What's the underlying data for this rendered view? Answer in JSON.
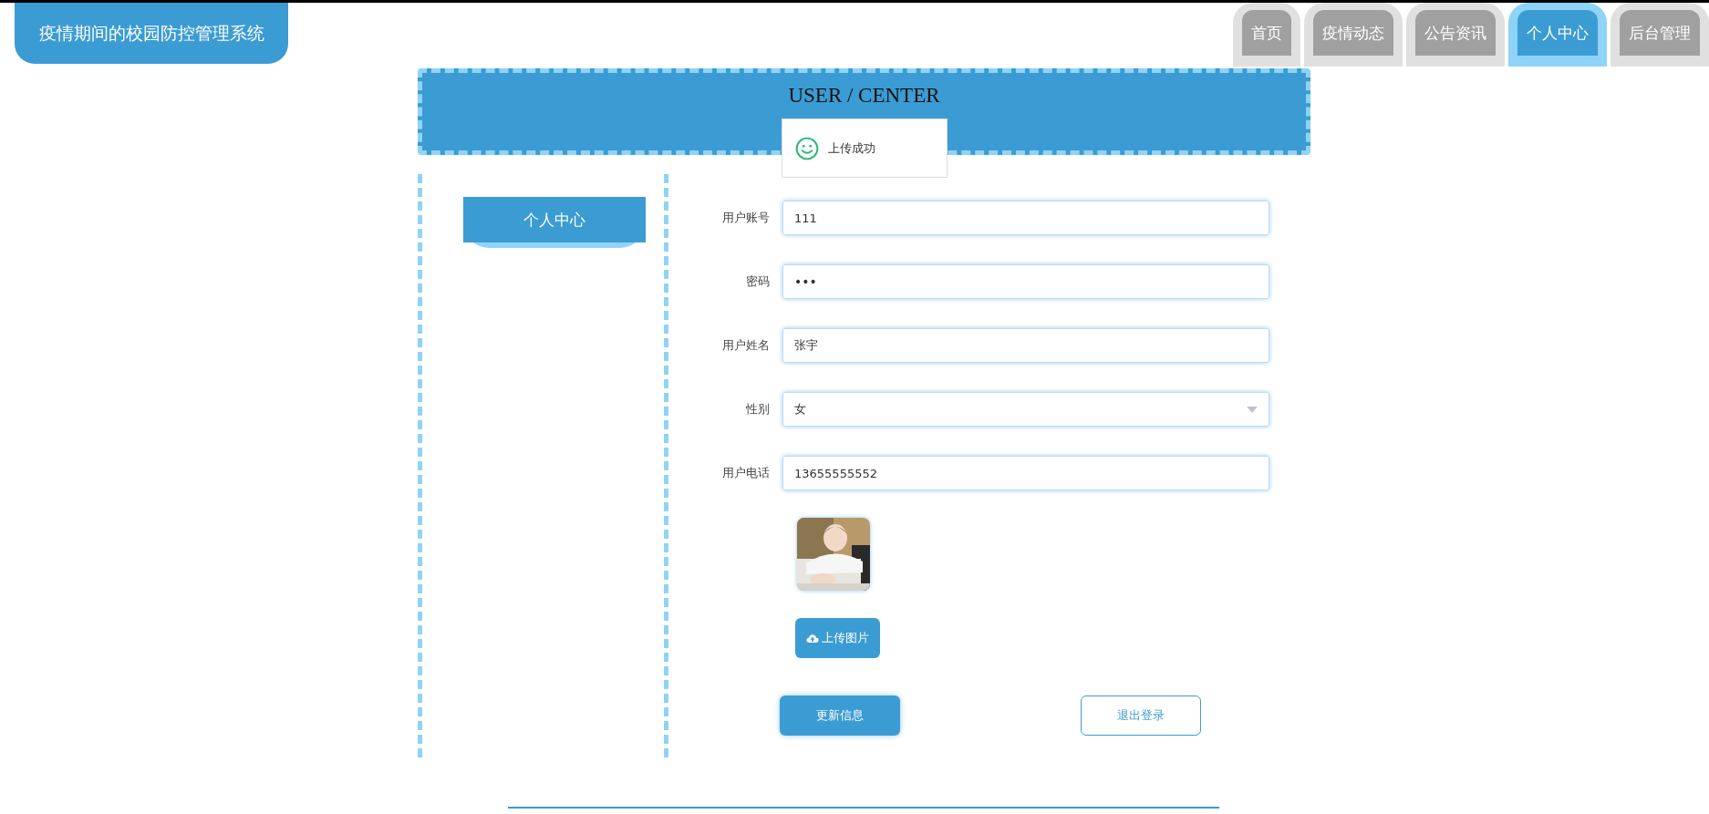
{
  "site_title": "疫情期间的校园防控管理系统",
  "nav": [
    {
      "label": "首页",
      "selected": false
    },
    {
      "label": "疫情动态",
      "selected": false
    },
    {
      "label": "公告资讯",
      "selected": false
    },
    {
      "label": "个人中心",
      "selected": true
    },
    {
      "label": "后台管理",
      "selected": false
    }
  ],
  "banner": {
    "title": "USER / CENTER"
  },
  "toast": {
    "message": "上传成功"
  },
  "sidebar": {
    "items": [
      {
        "label": "个人中心",
        "selected": true
      }
    ]
  },
  "form": {
    "fields": [
      {
        "label": "用户账号",
        "kind": "text",
        "value": "111"
      },
      {
        "label": "密码",
        "kind": "password",
        "value": "•••"
      },
      {
        "label": "用户姓名",
        "kind": "text",
        "value": "张宇"
      },
      {
        "label": "性别",
        "kind": "select",
        "value": "女"
      },
      {
        "label": "用户电话",
        "kind": "text",
        "value": "13655555552"
      }
    ],
    "upload_button": "上传图片",
    "update_button": "更新信息",
    "logout_button": "退出登录"
  }
}
